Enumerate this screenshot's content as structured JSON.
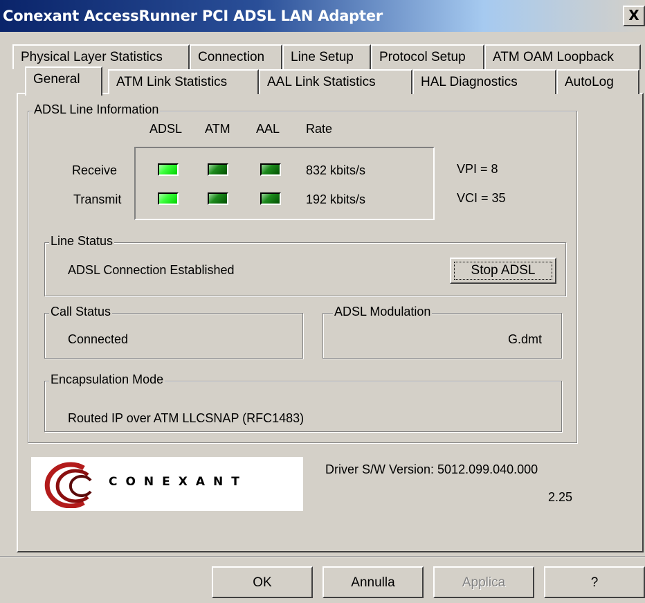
{
  "window": {
    "title": "Conexant AccessRunner PCI ADSL LAN Adapter",
    "close_glyph": "X"
  },
  "tabs": {
    "back_row": [
      "Physical Layer Statistics",
      "Connection",
      "Line Setup",
      "Protocol Setup",
      "ATM OAM Loopback"
    ],
    "front_row": [
      "General",
      "ATM Link Statistics",
      "AAL Link Statistics",
      "HAL Diagnostics",
      "AutoLog"
    ],
    "active": "General"
  },
  "adsl_info": {
    "legend": "ADSL Line Information",
    "headers": {
      "adsl": "ADSL",
      "atm": "ATM",
      "aal": "AAL",
      "rate": "Rate"
    },
    "rows": [
      {
        "label": "Receive",
        "rate": "832 kbits/s",
        "vp": "VPI = 8",
        "leds": [
          "bright",
          "dark",
          "dark"
        ]
      },
      {
        "label": "Transmit",
        "rate": "192 kbits/s",
        "vp": "VCI = 35",
        "leds": [
          "bright",
          "dark",
          "dark"
        ]
      }
    ],
    "led_color_bright": "#3cff3c",
    "led_color_dark": "#1c8a1c"
  },
  "line_status": {
    "legend": "Line Status",
    "text": "ADSL Connection Established",
    "button": "Stop ADSL"
  },
  "call_status": {
    "legend": "Call Status",
    "text": "Connected"
  },
  "modulation": {
    "legend": "ADSL Modulation",
    "text": "G.dmt"
  },
  "encapsulation": {
    "legend": "Encapsulation Mode",
    "text": "Routed IP over ATM LLCSNAP (RFC1483)"
  },
  "logo": {
    "text": "CONEXANT"
  },
  "driver": {
    "version_label": "Driver S/W Version: 5012.099.040.000",
    "sub_version": "2.25"
  },
  "buttons": {
    "ok": "OK",
    "cancel": "Annulla",
    "apply": "Applica",
    "help": "?"
  }
}
